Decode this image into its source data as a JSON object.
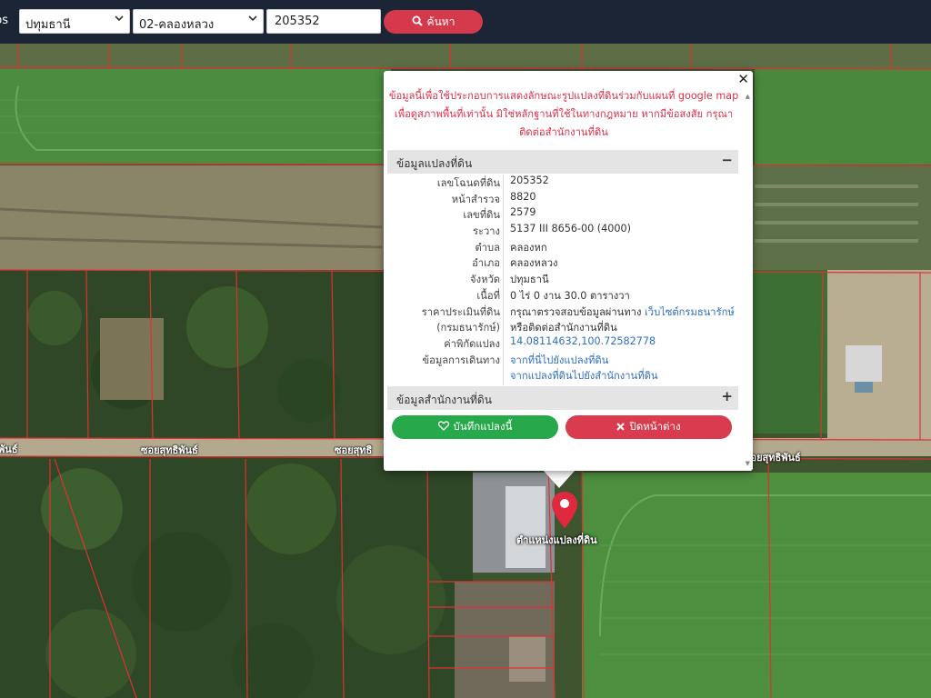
{
  "header": {
    "brand_fragment": "ps",
    "province": "ปทุมธานี",
    "district": "02-คลองหลวง",
    "parcel_number": "205352",
    "search_label": "ค้นหา",
    "select_icon": "chevron-down-icon",
    "search_icon": "search-icon"
  },
  "map": {
    "road_labels": [
      "ซอยสุทธิพันธ์",
      "ซอยสุทธิพันธ์",
      "ซอยสุทธิ",
      "พันธ์",
      "ซอยสุทธิพันธ์"
    ],
    "marker_label": "ตำแหน่งแปลงที่ดิน",
    "marker_icon": "map-pin-icon"
  },
  "popup": {
    "close_icon": "close-icon",
    "disclaimer": "ข้อมูลนี้เพื่อใช้ประกอบการแสดงลักษณะรูปแปลงที่ดินร่วมกับแผนที่ google map เพื่อดูสภาพพื้นที่เท่านั้น มิใช่หลักฐานที่ใช้ในทางกฎหมาย หากมีข้อสงสัย กรุณาติดต่อสำนักงานที่ดิน",
    "section_parcel": "ข้อมูลแปลงที่ดิน",
    "section_parcel_toggle": "−",
    "section_office": "ข้อมูลสำนักงานที่ดิน",
    "section_office_toggle": "+",
    "rows": [
      {
        "label": "เลขโฉนดที่ดิน",
        "value": "205352"
      },
      {
        "label": "หน้าสำรวจ",
        "value": "8820"
      },
      {
        "label": "เลขที่ดิน",
        "value": "2579"
      },
      {
        "label": "ระวาง",
        "value": "5137 III 8656-00 (4000)"
      },
      {
        "label": "ตำบล",
        "value": "คลองหก"
      },
      {
        "label": "อำเภอ",
        "value": "คลองหลวง"
      },
      {
        "label": "จังหวัด",
        "value": "ปทุมธานี"
      },
      {
        "label": "เนื้อที่",
        "value": "0 ไร่ 0 งาน 30.0 ตารางวา"
      }
    ],
    "appraisal_label_1": "ราคาประเมินที่ดิน",
    "appraisal_label_2": "(กรมธนารักษ์)",
    "appraisal_value_1": "กรุณาตรวจสอบข้อมูลผ่านทาง",
    "appraisal_link": "เว็บไซต์กรมธนารักษ์",
    "appraisal_value_2": "หรือติดต่อสำนักงานที่ดิน",
    "coord_label": "ค่าพิกัดแปลง",
    "coord_value": "14.08114632,100.72582778",
    "travel_label": "ข้อมูลการเดินทาง",
    "travel_link_1": "จากที่นี่ไปยังแปลงที่ดิน",
    "travel_link_2": "จากแปลงที่ดินไปยังสำนักงานที่ดิน",
    "save_label": "บันทึกแปลงนี้",
    "save_icon": "heart-icon",
    "close_window_label": "ปิดหน้าต่าง",
    "close_window_icon": "x-icon"
  },
  "colors": {
    "topbar": "#1b2535",
    "search_button": "#d43a4c",
    "disclaimer_text": "#d9304a",
    "link": "#2f6fc4",
    "save_button": "#27a84a",
    "close_button": "#d93c4e",
    "parcel_lines": "#e03030",
    "marker": "#e0283f"
  }
}
